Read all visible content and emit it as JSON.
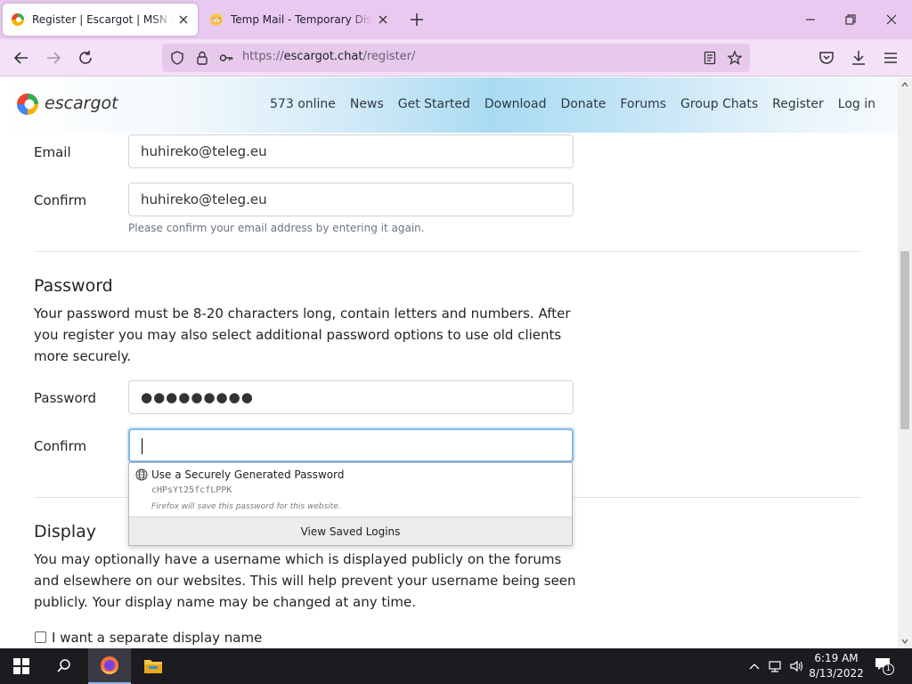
{
  "browser": {
    "tabs": [
      {
        "title": "Register | Escargot | MSN Messenger",
        "active": true
      },
      {
        "title": "Temp Mail - Temporary Disposable Email",
        "active": false
      }
    ],
    "url_prefix": "https://",
    "url_host": "escargot.chat",
    "url_path": "/register/"
  },
  "site": {
    "brand": "escargot",
    "nav": [
      "573 online",
      "News",
      "Get Started",
      "Download",
      "Donate",
      "Forums",
      "Group Chats",
      "Register",
      "Log in"
    ]
  },
  "form": {
    "email_label": "Email",
    "email_value": "huhireko@teleg.eu",
    "confirm_email_label": "Confirm",
    "confirm_email_value": "huhireko@teleg.eu",
    "confirm_email_hint": "Please confirm your email address by entering it again.",
    "password_heading": "Password",
    "password_help": "Your password must be 8-20 characters long, contain letters and numbers. After you register you may also select additional password options to use old clients more securely.",
    "password_label": "Password",
    "password_value": "●●●●●●●●●",
    "confirm_password_label": "Confirm",
    "confirm_password_value": "",
    "display_heading": "Display",
    "display_help": "You may optionally have a username which is displayed publicly on the forums and elsewhere on our websites. This will help prevent your username being seen publicly. Your display name may be changed at any time.",
    "display_checkbox_label": "I want a separate display name",
    "display_checkbox_checked": false
  },
  "password_popup": {
    "title": "Use a Securely Generated Password",
    "generated": "cHPsYt25fcfLPPK",
    "note": "Firefox will save this password for this website.",
    "footer": "View Saved Logins"
  },
  "taskbar": {
    "time": "6:19 AM",
    "date": "8/13/2022",
    "notification_count": "1"
  },
  "colors": {
    "tabbar": "#e9c9ef",
    "navbar": "#f4e1f7",
    "taskbar": "#1b1b20"
  }
}
